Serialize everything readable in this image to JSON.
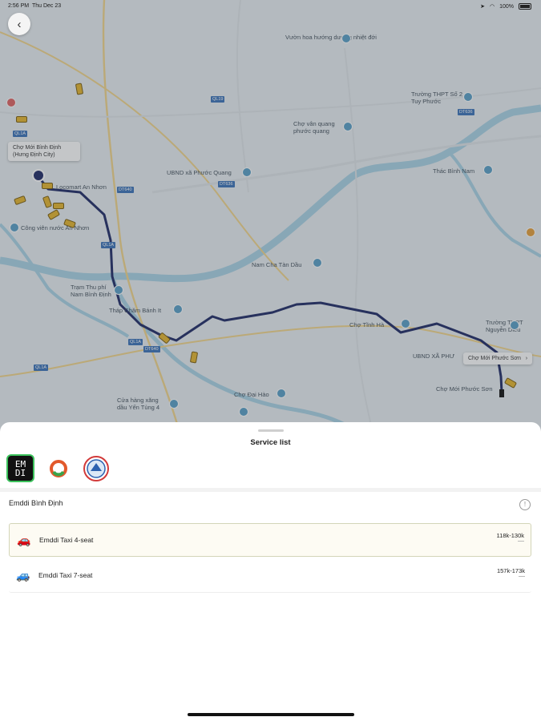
{
  "status_bar": {
    "time": "2:56 PM",
    "date": "Thu Dec 23",
    "battery": "100%"
  },
  "map": {
    "labels": [
      "Vườn hoa hướng dương nhiệt đới",
      "Trường THPT Số 2 Tuy Phước",
      "Chợ vân quang phước quang",
      "Chợ Mới Bình Định (Hưng Định City)",
      "UBND xã Phước Quang",
      "Thác Bình Nam",
      "Locomart An Nhơn",
      "Công viên nước An Nhơn",
      "Nam Cha Tàn Dầu",
      "Trạm Thu phí Nam Bình Định",
      "Tháp Chăm Bánh It",
      "Chợ Tĩnh Hà",
      "Trường THPT Nguyễn Diêu",
      "UBND XÃ PHƯ",
      "Chợ Mới Phước Sơn",
      "Cửa hàng xăng dầu Yến Tùng 4",
      "Chợ Đại Hào"
    ],
    "road_badges": [
      "DT636",
      "DT636",
      "QL1A",
      "DT640",
      "QL1A",
      "QL19",
      "QL1A",
      "QL1A",
      "DT640"
    ],
    "destination_callout": "Chợ Mới Phước Sơn",
    "origin_callout": "Chợ Mới Bình Định (Hưng Định City)"
  },
  "sheet": {
    "title": "Service list",
    "providers": [
      {
        "name": "Emddi",
        "logo_text": "EM DI",
        "icon": "emddi-logo-icon"
      },
      {
        "name": "orange-swirl",
        "icon": "orange-swirl-logo-icon"
      },
      {
        "name": "round-emblem",
        "icon": "round-emblem-logo-icon"
      }
    ],
    "group_name": "Emddi Bình Định",
    "services": [
      {
        "name": "Emddi Taxi 4-seat",
        "price": "118k-130k",
        "selected": true
      },
      {
        "name": "Emddi Taxi 7-seat",
        "price": "157k-173k",
        "selected": false
      }
    ]
  },
  "colors": {
    "route": "#1f2a66",
    "selected_border": "#d3d5b8",
    "emddi_green": "#3cc25c",
    "map_water": "#a9d3e6"
  }
}
